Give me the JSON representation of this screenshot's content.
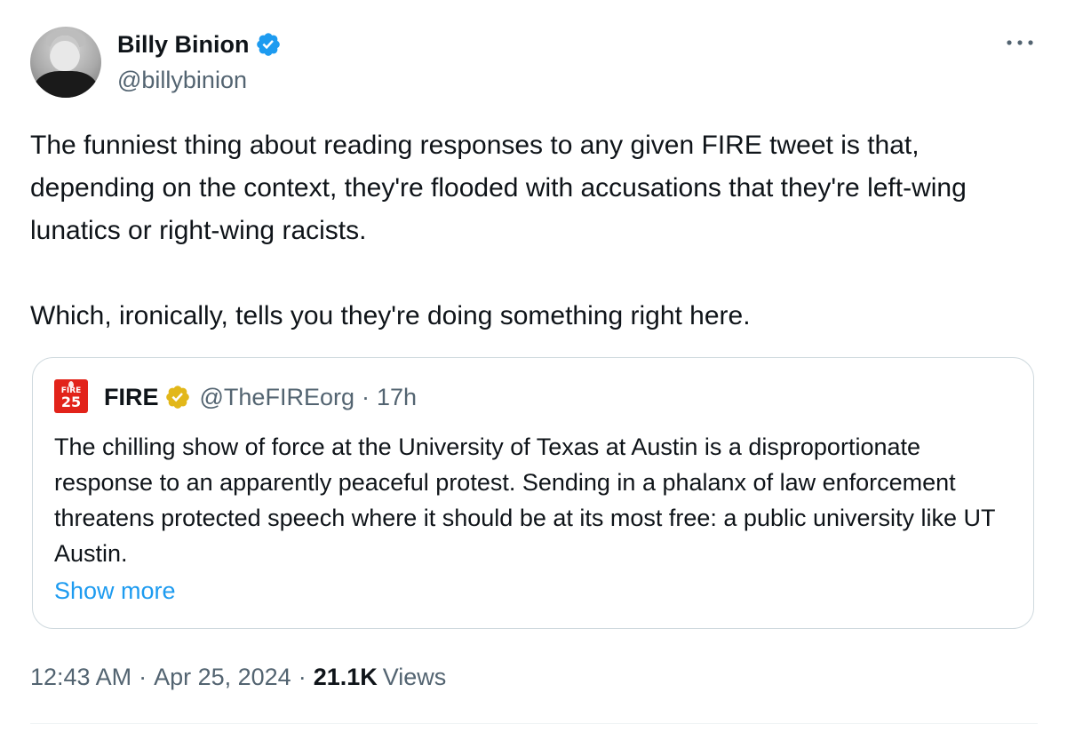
{
  "author": {
    "name": "Billy Binion",
    "handle": "@billybinion",
    "verified_badge_color": "#1d9bf0",
    "avatar_icon": "profile-photo"
  },
  "more_icon": "ellipsis-icon",
  "tweet": {
    "text": "The funniest thing about reading responses to any given FIRE tweet is that, depending on the context, they're flooded with accusations that they're left-wing lunatics or right-wing racists.\n\nWhich, ironically, tells you they're doing something right here."
  },
  "quoted_tweet": {
    "logo_text_top": "FIRE",
    "logo_text_bottom": "25",
    "logo_color": "#e2231a",
    "name": "FIRE",
    "verified_badge_color": "#e2b719",
    "handle": "@TheFIREorg",
    "separator": "·",
    "time": "17h",
    "text": "The chilling show of force at the University of Texas at Austin is a disproportionate response to an apparently peaceful protest. Sending in a phalanx of law enforcement threatens protected speech where it should be at its most free: a public university like UT Austin.",
    "show_more": "Show more",
    "link_color": "#1d9bf0"
  },
  "meta": {
    "time": "12:43 AM",
    "separator": "·",
    "date": "Apr 25, 2024",
    "views_count": "21.1K",
    "views_label": "Views"
  }
}
